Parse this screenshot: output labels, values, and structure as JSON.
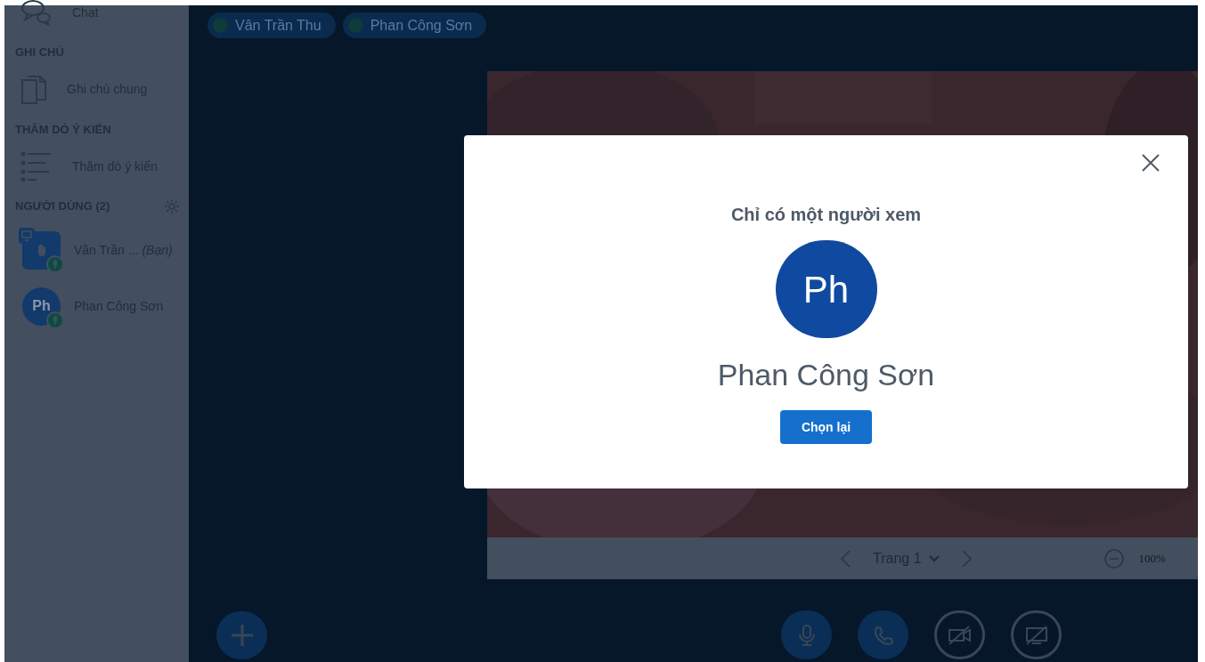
{
  "sidebar": {
    "sections": [
      {
        "items": [
          {
            "kind": "chat",
            "label": "Chat"
          }
        ]
      },
      {
        "title": "GHI CHÚ",
        "items": [
          {
            "kind": "notes",
            "label": "Ghi chú chung"
          }
        ]
      },
      {
        "title": "THĂM DÒ Ý KIẾN",
        "items": [
          {
            "kind": "poll",
            "label": "Thăm dò ý kiến"
          }
        ]
      }
    ],
    "users": {
      "title": "NGƯỜI DÙNG (2)",
      "items": [
        {
          "kind": "presenter",
          "name": "Vân Trần ...",
          "suffix": "(Bạn)"
        },
        {
          "kind": "initials",
          "initials": "Ph",
          "name": "Phan Công Sơn"
        }
      ]
    }
  },
  "talkers": [
    {
      "name": "Vân Trần Thu"
    },
    {
      "name": "Phan Công Sơn"
    }
  ],
  "presentation": {
    "page": "Trang 1",
    "zoom": "100%"
  },
  "controls": [
    {
      "kind": "mic",
      "active": true
    },
    {
      "kind": "phone",
      "active": true
    },
    {
      "kind": "video",
      "active": false
    },
    {
      "kind": "screen",
      "active": false
    }
  ],
  "modal": {
    "title": "Chỉ có một người xem",
    "initials": "Ph",
    "name": "Phan Công Sơn",
    "button": "Chọn lại"
  }
}
